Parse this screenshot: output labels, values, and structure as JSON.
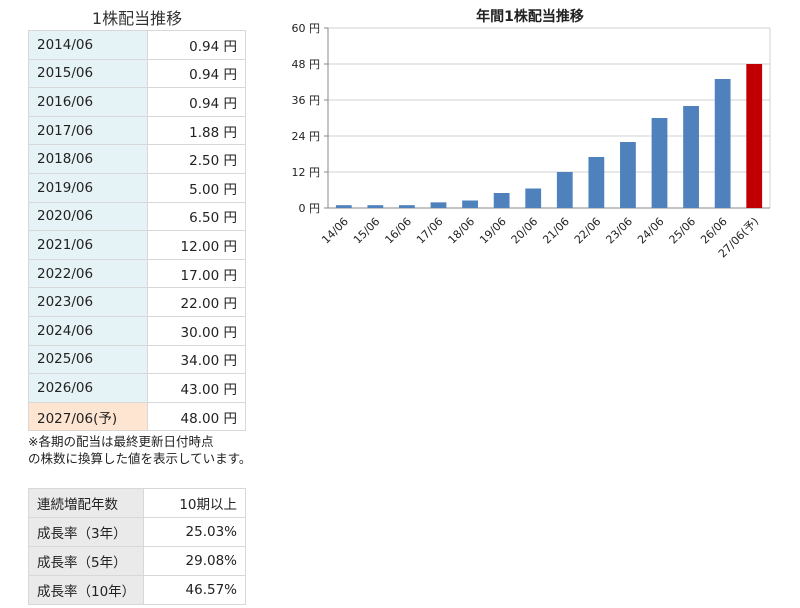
{
  "dividend_table": {
    "title": "1株配当推移",
    "rows": [
      {
        "period": "2014/06",
        "value": "0.94 円"
      },
      {
        "period": "2015/06",
        "value": "0.94 円"
      },
      {
        "period": "2016/06",
        "value": "0.94 円"
      },
      {
        "period": "2017/06",
        "value": "1.88 円"
      },
      {
        "period": "2018/06",
        "value": "2.50 円"
      },
      {
        "period": "2019/06",
        "value": "5.00 円"
      },
      {
        "period": "2020/06",
        "value": "6.50 円"
      },
      {
        "period": "2021/06",
        "value": "12.00 円"
      },
      {
        "period": "2022/06",
        "value": "17.00 円"
      },
      {
        "period": "2023/06",
        "value": "22.00 円"
      },
      {
        "period": "2024/06",
        "value": "30.00 円"
      },
      {
        "period": "2025/06",
        "value": "34.00 円"
      },
      {
        "period": "2026/06",
        "value": "43.00 円"
      },
      {
        "period": "2027/06(予)",
        "value": "48.00 円"
      }
    ],
    "note_line1": "※各期の配当は最終更新日付時点",
    "note_line2": "の株数に換算した値を表示しています。"
  },
  "growth_table": {
    "rows": [
      {
        "label": "連続増配年数",
        "value": "10期以上"
      },
      {
        "label": "成長率（3年）",
        "value": "25.03%"
      },
      {
        "label": "成長率（5年）",
        "value": "29.08%"
      },
      {
        "label": "成長率（10年）",
        "value": "46.57%"
      }
    ]
  },
  "chart_data": {
    "type": "bar",
    "title": "年間1株配当推移",
    "categories": [
      "14/06",
      "15/06",
      "16/06",
      "17/06",
      "18/06",
      "19/06",
      "20/06",
      "21/06",
      "22/06",
      "23/06",
      "24/06",
      "25/06",
      "26/06",
      "27/06(予)"
    ],
    "values": [
      0.94,
      0.94,
      0.94,
      1.88,
      2.5,
      5.0,
      6.5,
      12.0,
      17.0,
      22.0,
      30.0,
      34.0,
      43.0,
      48.0
    ],
    "forecast_index": 13,
    "ylim": [
      0,
      60
    ],
    "yticks": [
      0,
      12,
      24,
      36,
      48,
      60
    ],
    "ytick_suffix": " 円",
    "grid": true,
    "colors": {
      "actual": "#4f81bd",
      "forecast": "#c00000",
      "grid": "#d0d0d0"
    }
  }
}
